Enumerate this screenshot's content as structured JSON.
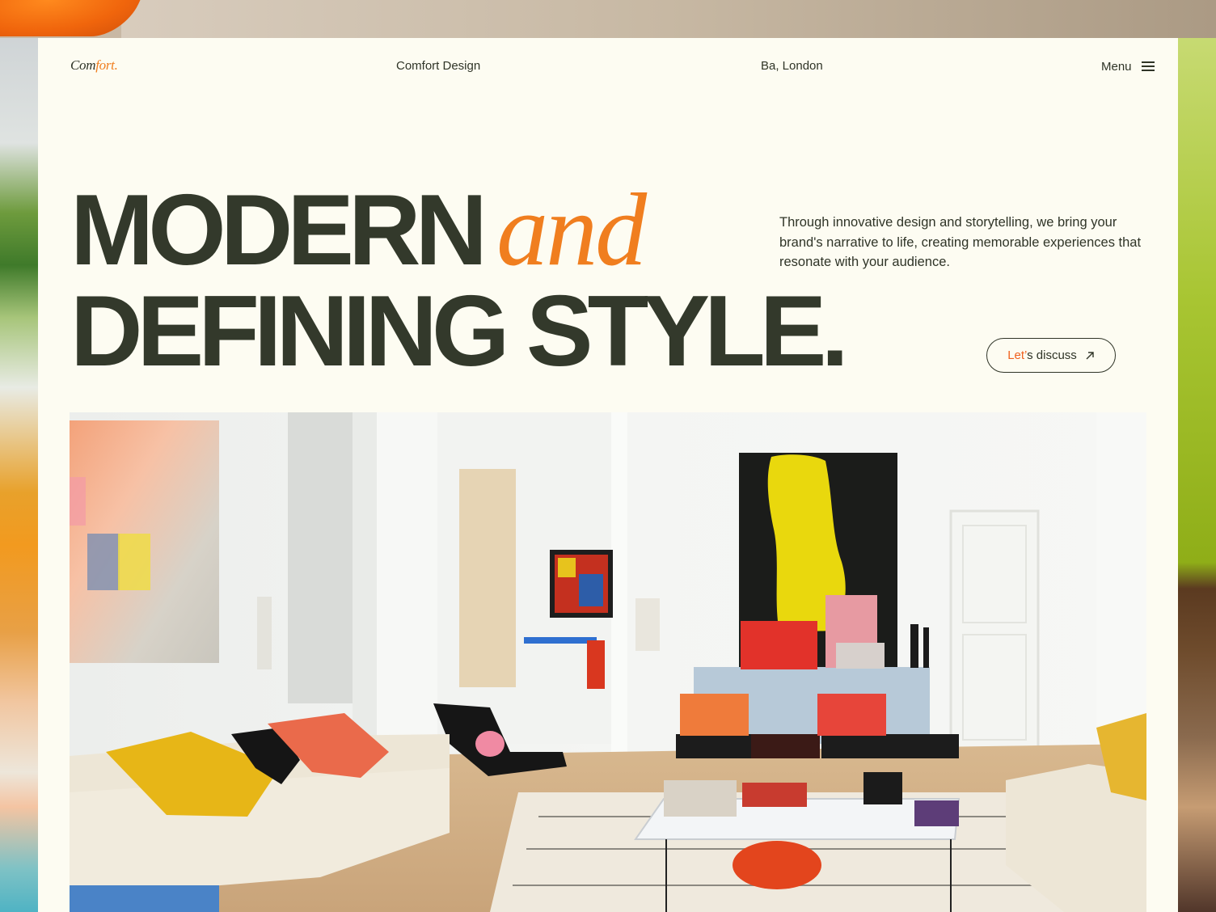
{
  "header": {
    "brand_text_main": "Com",
    "brand_text_accent": "fort.",
    "studio_name": "Comfort Design",
    "location": "Ba, London",
    "menu_label": "Menu"
  },
  "hero": {
    "headline_word1": "MODERN",
    "headline_word2": "and",
    "headline_line2": "DEFINING STYLE.",
    "tagline": "Through innovative design and storytelling, we bring your brand's narrative to life, creating memorable experiences that resonate with your audience.",
    "cta_accent": "Let’",
    "cta_rest": "s discuss",
    "cta_icon": "arrow-up-right-icon"
  },
  "colors": {
    "background": "#fdfcf2",
    "text": "#33392b",
    "accent": "#f07e1f",
    "cta_accent": "#f0611f"
  }
}
